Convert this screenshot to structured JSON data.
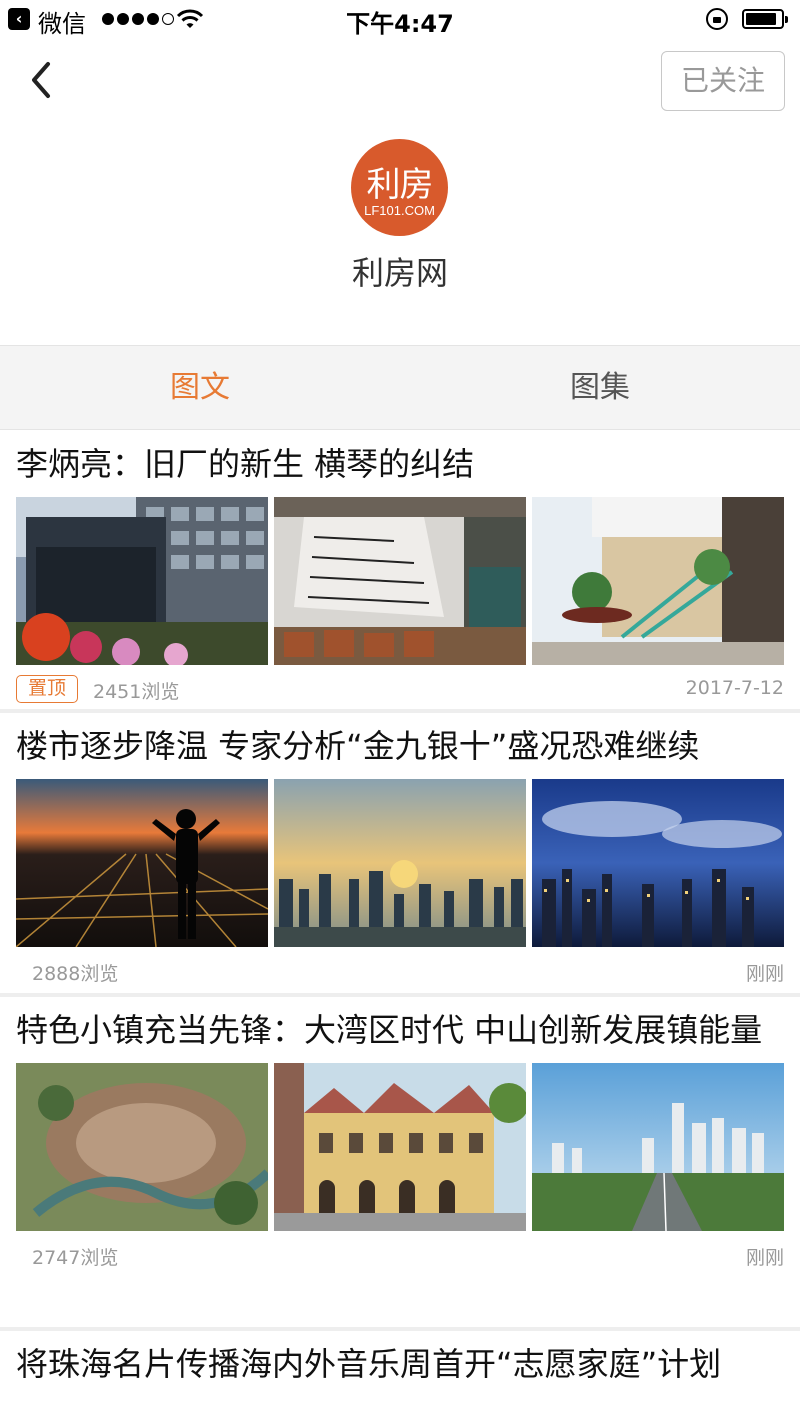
{
  "status_bar": {
    "app_name": "微信",
    "time": "下午4:47"
  },
  "header": {
    "follow_label": "已关注",
    "logo_text": "利房",
    "logo_subtext": "LF101.COM",
    "account_name": "利房网"
  },
  "tabs": [
    {
      "label": "图文",
      "active": true
    },
    {
      "label": "图集",
      "active": false
    }
  ],
  "articles": [
    {
      "title": "李炳亮：旧厂的新生 横琴的纠结",
      "pinned": true,
      "badge": "置顶",
      "views": "2451浏览",
      "date": "2017-7-12"
    },
    {
      "title": "楼市逐步降温 专家分析“金九银十”盛况恐难继续",
      "pinned": false,
      "views": "2888浏览",
      "date": "刚刚"
    },
    {
      "title": "特色小镇充当先锋：大湾区时代 中山创新发展镇能量",
      "pinned": false,
      "views": "2747浏览",
      "date": "刚刚"
    },
    {
      "title": "将珠海名片传播海内外音乐周首开“志愿家庭”计划",
      "pinned": false
    }
  ],
  "colors": {
    "accent": "#e77a34",
    "logo_bg": "#d85a2c"
  }
}
